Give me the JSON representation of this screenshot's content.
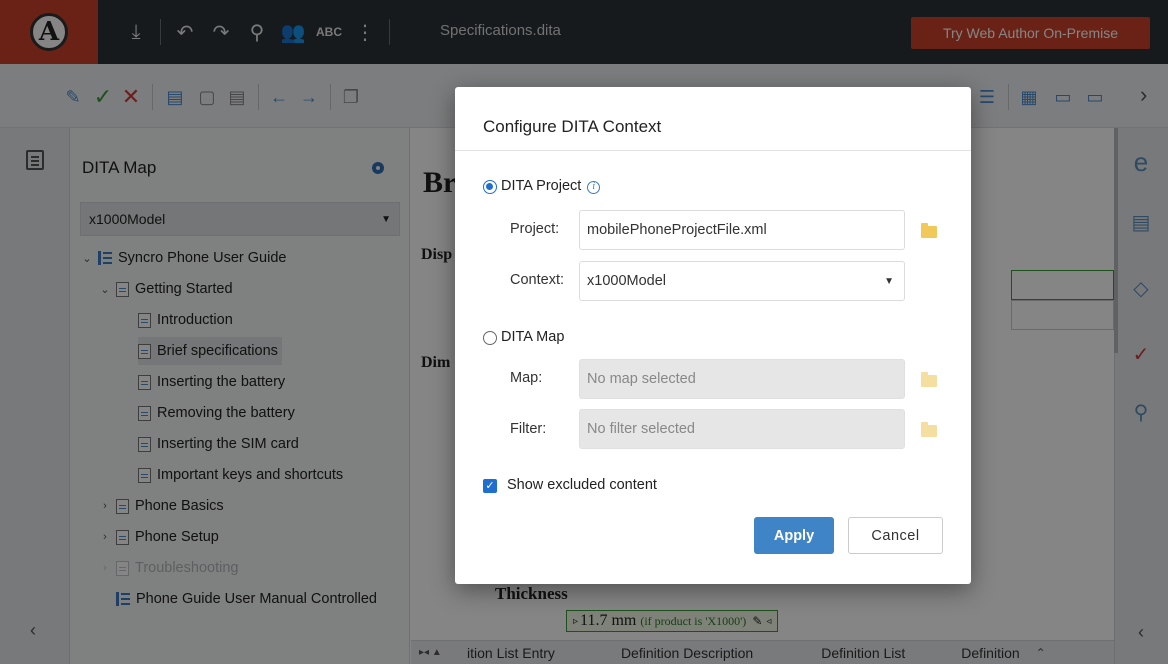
{
  "topbar": {
    "filename": "Specifications.dita",
    "try_button": "Try Web Author On-Premise",
    "logo_letter": "A",
    "tools": [
      "download-icon",
      "undo-icon",
      "redo-icon",
      "search-icon",
      "people-icon",
      "spellcheck-icon",
      "more-icon"
    ]
  },
  "map_panel": {
    "title": "DITA Map",
    "selected_map": "x1000Model",
    "tree": [
      {
        "label": "Syncro Phone User Guide"
      },
      {
        "label": "Getting Started"
      },
      {
        "label": "Introduction"
      },
      {
        "label": "Brief specifications"
      },
      {
        "label": "Inserting the battery"
      },
      {
        "label": "Removing the battery"
      },
      {
        "label": "Inserting the SIM card"
      },
      {
        "label": "Important keys and shortcuts"
      },
      {
        "label": "Phone Basics"
      },
      {
        "label": "Phone Setup"
      },
      {
        "label": "Troubleshooting"
      },
      {
        "label": "Phone Guide User Manual Controlled"
      }
    ]
  },
  "editor": {
    "heading_fragment": "Br",
    "disp_fragment": "Disp",
    "dim_fragment": "Dim",
    "thickness_label": "Thickness",
    "thickness_value": "11.7 mm",
    "condition_note": "(if product is 'X1000')"
  },
  "breadcrumbs": [
    "ition List Entry",
    "Definition Description",
    "Definition List",
    "Definition"
  ],
  "dialog": {
    "title": "Configure DITA Context",
    "option_project": "DITA Project",
    "project_label": "Project:",
    "project_value": "mobilePhoneProjectFile.xml",
    "context_label": "Context:",
    "context_value": "x1000Model",
    "option_map": "DITA Map",
    "map_label": "Map:",
    "map_placeholder": "No map selected",
    "filter_label": "Filter:",
    "filter_placeholder": "No filter selected",
    "show_excluded": "Show excluded content",
    "apply": "Apply",
    "cancel": "Cancel"
  },
  "colors": {
    "topbar": "#2b3238",
    "accent_red": "#c9422a",
    "primary_blue": "#3f84c7"
  }
}
